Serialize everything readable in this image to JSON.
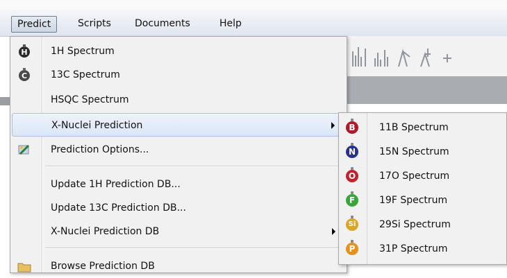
{
  "menubar": {
    "items": [
      "Predict",
      "Scripts",
      "Documents",
      "Help"
    ]
  },
  "predict_menu": {
    "items": [
      {
        "label": "1H Spectrum",
        "icon": "h-atom-icon"
      },
      {
        "label": "13C Spectrum",
        "icon": "c-atom-icon"
      },
      {
        "label": "HSQC Spectrum",
        "icon": ""
      },
      {
        "label": "X-Nuclei Prediction",
        "icon": "",
        "has_submenu": true
      },
      {
        "label": "Prediction Options...",
        "icon": "options-icon"
      },
      {
        "label": "Update 1H Prediction DB...",
        "icon": ""
      },
      {
        "label": "Update 13C Prediction DB...",
        "icon": ""
      },
      {
        "label": "X-Nuclei Prediction DB",
        "icon": "",
        "has_submenu": true
      },
      {
        "label": "Browse Prediction DB",
        "icon": "folder-icon"
      }
    ]
  },
  "xnuclei_submenu": {
    "items": [
      {
        "label": "11B Spectrum",
        "letter": "B",
        "color": "#b0192a"
      },
      {
        "label": "15N Spectrum",
        "letter": "N",
        "color": "#27318f"
      },
      {
        "label": "17O Spectrum",
        "letter": "O",
        "color": "#c2202c"
      },
      {
        "label": "19F Spectrum",
        "letter": "F",
        "color": "#3aa53a"
      },
      {
        "label": "29Si Spectrum",
        "letter": "Si",
        "color": "#d9a52a"
      },
      {
        "label": "31P Spectrum",
        "letter": "P",
        "color": "#e8911a"
      }
    ]
  }
}
